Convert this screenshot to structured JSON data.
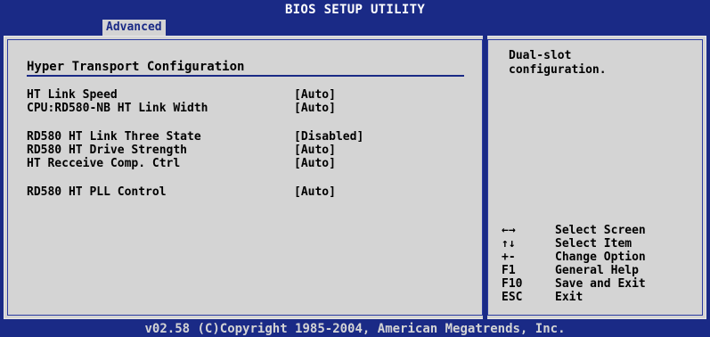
{
  "header": {
    "title": "BIOS SETUP UTILITY",
    "active_tab": "Advanced"
  },
  "main": {
    "section_title": "Hyper Transport Configuration",
    "settings": [
      {
        "label": "HT Link Speed",
        "value": "[Auto]"
      },
      {
        "label": "CPU:RD580-NB HT Link Width",
        "value": "[Auto]"
      },
      {
        "label": "RD580 HT Link Three State",
        "value": "[Disabled]"
      },
      {
        "label": "RD580 HT Drive Strength",
        "value": "[Auto]"
      },
      {
        "label": "HT Recceive Comp. Ctrl",
        "value": "[Auto]"
      },
      {
        "label": "RD580 HT PLL Control",
        "value": "[Auto]"
      }
    ]
  },
  "help": {
    "text": "Dual-slot\nconfiguration."
  },
  "keys": [
    {
      "key_icon": "left-right-arrows-icon",
      "key": "←→",
      "desc": "Select Screen"
    },
    {
      "key_icon": "up-down-arrows-icon",
      "key": "↑↓",
      "desc": "Select Item"
    },
    {
      "key": "+-",
      "desc": "Change Option"
    },
    {
      "key": "F1",
      "desc": "General Help"
    },
    {
      "key": "F10",
      "desc": "Save and Exit"
    },
    {
      "key": "ESC",
      "desc": "Exit"
    }
  ],
  "footer": {
    "text": "v02.58 (C)Copyright 1985-2004, American Megatrends, Inc."
  },
  "colors": {
    "background_blue": "#1a2a86",
    "panel_gray": "#d4d4d4",
    "text": "#000000"
  }
}
